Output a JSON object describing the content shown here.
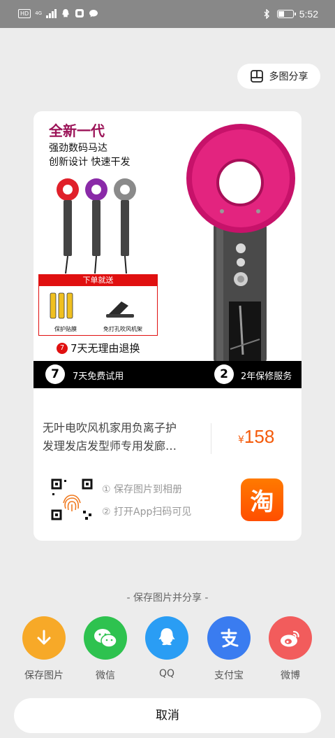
{
  "status_bar": {
    "hd": "HD",
    "network": "4G",
    "time": "5:52"
  },
  "multi_share_label": "多图分享",
  "product": {
    "image": {
      "headline": "全新一代",
      "sub1": "强劲数码马达",
      "sub2": "创新设计  快速干发",
      "gift_header": "下单就送",
      "gift_item1": "保护贴膜",
      "gift_item2": "免打孔吹风机架",
      "return_num": "7",
      "return_text": "7天无理由退换",
      "band_num1": "7",
      "band_text1": "7天免费试用",
      "band_num2": "2",
      "band_text2": "2年保修服务"
    },
    "title_line1": "无叶电吹风机家用负离子护",
    "title_line2": "发理发店发型师专用发廊…",
    "currency": "¥",
    "price": "158",
    "step1": "① 保存图片到相册",
    "step2": "② 打开App扫码可见",
    "taobao_char": "淘"
  },
  "share": {
    "title": "- 保存图片并分享 -",
    "items": [
      {
        "label": "保存图片",
        "icon": "download-icon",
        "color": "#f7a928"
      },
      {
        "label": "微信",
        "icon": "wechat-icon",
        "color": "#2ec24f"
      },
      {
        "label": "QQ",
        "icon": "qq-icon",
        "color": "#2a9df4"
      },
      {
        "label": "支付宝",
        "icon": "alipay-icon",
        "color": "#3a7cf0"
      },
      {
        "label": "微博",
        "icon": "weibo-icon",
        "color": "#f25c5c"
      }
    ]
  },
  "cancel_label": "取消"
}
